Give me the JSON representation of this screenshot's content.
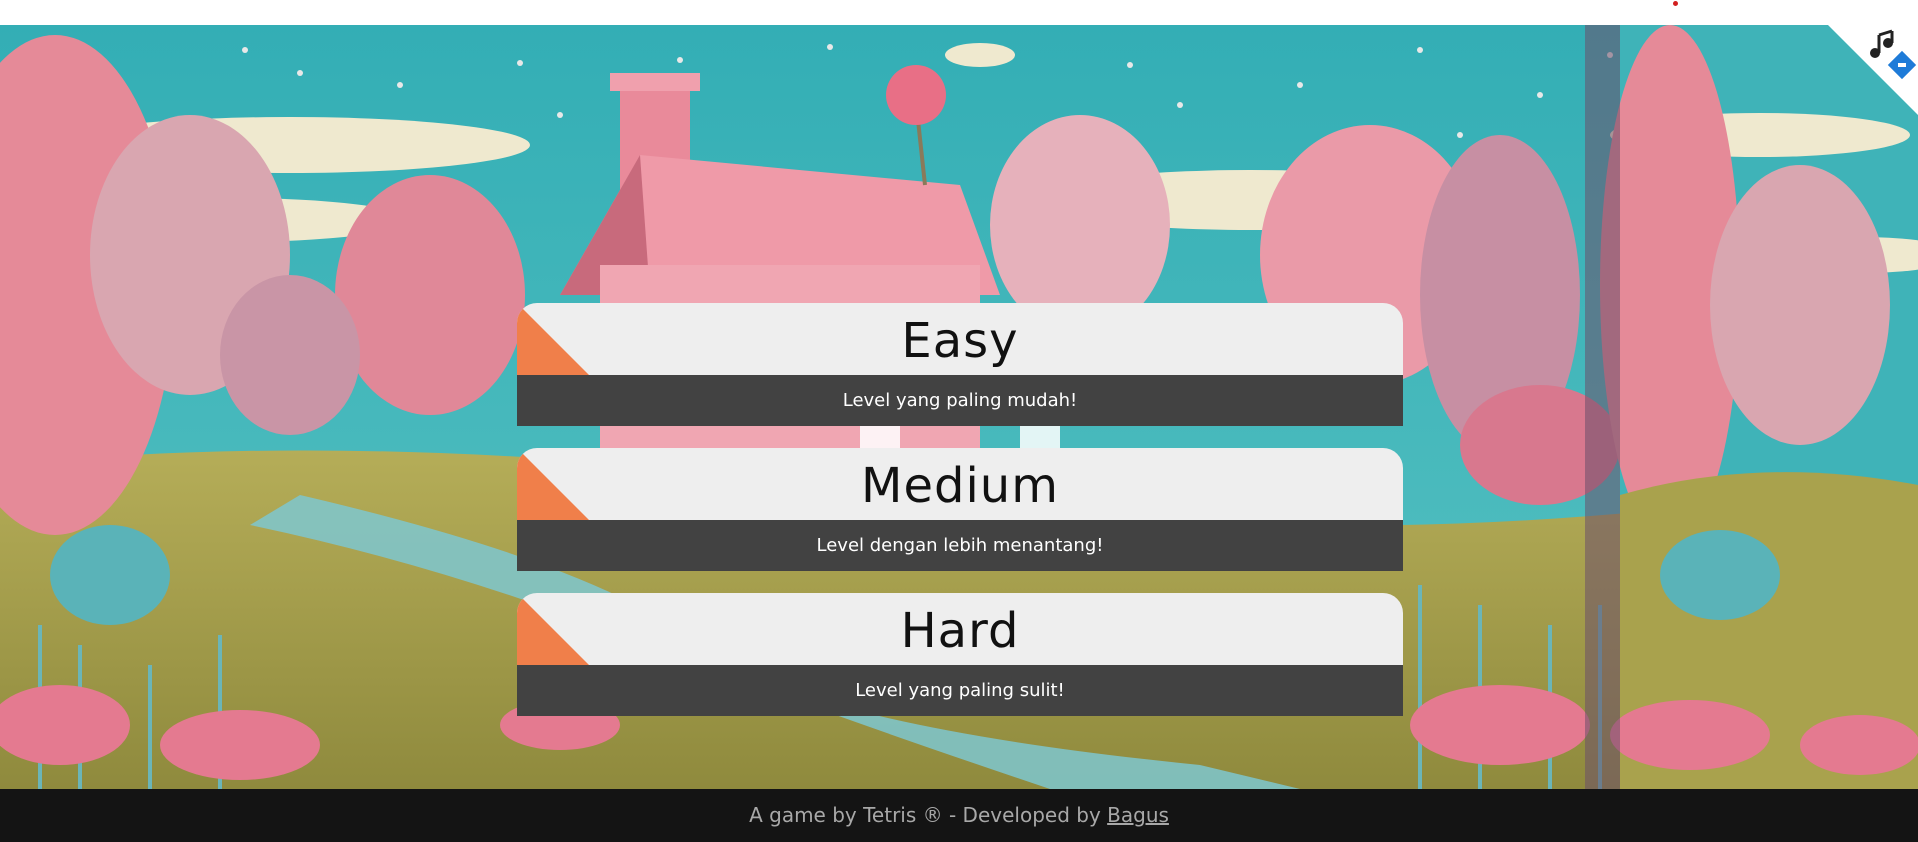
{
  "levels": [
    {
      "title": "Easy",
      "description": "Level yang paling mudah!"
    },
    {
      "title": "Medium",
      "description": "Level dengan lebih menantang!"
    },
    {
      "title": "Hard",
      "description": "Level yang paling sulit!"
    }
  ],
  "footer": {
    "text": "A game by Tetris ® - Developed by",
    "author_link": "Bagus"
  },
  "theme": {
    "accent": "#f07f4a",
    "card_head": "#eeeeee",
    "card_body": "#424242",
    "footer_bg": "#141414",
    "sky": "#3fb3b8",
    "tree_pink": "#e58a98",
    "grass": "#a9a24d"
  },
  "icons": {
    "corner": "music-note-icon",
    "toggle": "blue-diamond-icon"
  }
}
